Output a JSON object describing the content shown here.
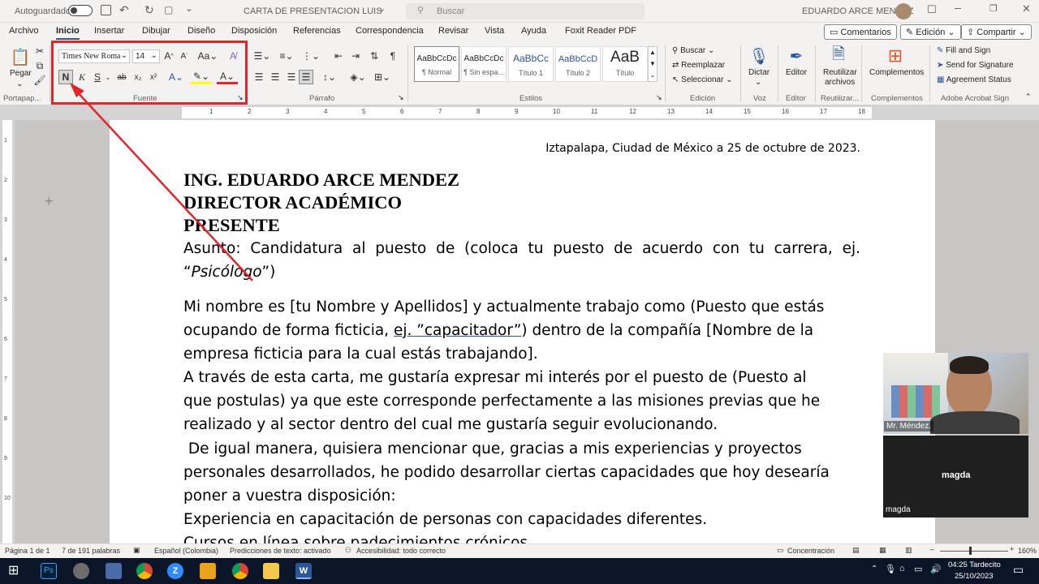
{
  "titlebar": {
    "autosave_label": "Autoguardado",
    "doc_title": "CARTA DE PRESENTACION LUIS",
    "dropdown_arrow": "⌄",
    "search_placeholder": "Buscar",
    "user_name": "EDUARDO ARCE MENDEZ"
  },
  "tabs": [
    "Archivo",
    "Inicio",
    "Insertar",
    "Dibujar",
    "Diseño",
    "Disposición",
    "Referencias",
    "Correspondencia",
    "Revisar",
    "Vista",
    "Ayuda",
    "Foxit Reader PDF"
  ],
  "top_buttons": {
    "comments": "Comentarios",
    "editing": "Edición",
    "share": "Compartir"
  },
  "ribbon": {
    "clipboard": {
      "paste": "Pegar",
      "label": "Portapap..."
    },
    "font": {
      "name": "Times New Roma",
      "size": "14",
      "bold": "N",
      "italic": "K",
      "underline": "S",
      "strike": "ab",
      "sub": "x₂",
      "sup": "x²",
      "label": "Fuente"
    },
    "paragraph": {
      "label": "Párrafo"
    },
    "styles": {
      "items": [
        {
          "preview": "AaBbCcDc",
          "name": "¶ Normal"
        },
        {
          "preview": "AaBbCcDc",
          "name": "¶ Sin espa..."
        },
        {
          "preview": "AaBbCc",
          "name": "Título 1"
        },
        {
          "preview": "AaBbCcD",
          "name": "Título 2"
        },
        {
          "preview": "AaB",
          "name": "Título"
        }
      ],
      "label": "Estilos"
    },
    "editing": {
      "find": "Buscar",
      "replace": "Reemplazar",
      "select": "Seleccionar",
      "label": "Edición"
    },
    "voice": {
      "dictate": "Dictar",
      "label": "Voz"
    },
    "editor": {
      "button": "Editor",
      "label": "Editor"
    },
    "reuse": {
      "button_line1": "Reutilizar",
      "button_line2": "archivos",
      "label": "Reutilizar..."
    },
    "addins": {
      "button": "Complementos",
      "label": "Complementos"
    },
    "acrobat": {
      "fill": "Fill and Sign",
      "send": "Send for Signature",
      "agreement": "Agreement Status",
      "label": "Adobe Acrobat Sign"
    }
  },
  "ruler_numbers": [
    "1",
    "2",
    "3",
    "4",
    "5",
    "6",
    "7",
    "8",
    "9",
    "10",
    "11",
    "12",
    "13",
    "14",
    "15",
    "16",
    "17",
    "18"
  ],
  "vruler_numbers": [
    "1",
    "2",
    "3",
    "4",
    "5",
    "6",
    "7",
    "8",
    "9",
    "10"
  ],
  "document": {
    "date_line": "Iztapalapa, Ciudad de México a 25 de octubre de 2023.",
    "heading1": "ING. EDUARDO ARCE MENDEZ",
    "heading2": "DIRECTOR ACADÉMICO",
    "heading3": "PRESENTE",
    "subject_line1": "Asunto: Candidatura al puesto de (coloca tu puesto de acuerdo con tu carrera, ej.",
    "subject_line2_pre": "“",
    "subject_line2_italic": "Psicólogo",
    "subject_line2_post": "”)",
    "p1_line1": "Mi nombre es [tu Nombre y Apellidos] y actualmente trabajo como (Puesto que estás",
    "p1_line2_pre": "ocupando de forma ficticia, ",
    "p1_line2_underlined": "ej. ”capacitador”",
    "p1_line2_post": ") dentro de la compañía [Nombre de la",
    "p1_line3": "empresa ficticia para la cual estás trabajando].",
    "p2_line1": "A través de esta carta, me gustaría expresar mi interés por el puesto de (Puesto al",
    "p2_line2": "que postulas) ya que este corresponde perfectamente a las misiones previas que he",
    "p2_line3": "realizado y al sector dentro del cual me gustaría seguir evolucionando.",
    "p3_line1": " De igual manera, quisiera mencionar que, gracias a mis experiencias y proyectos",
    "p3_line2": "personales desarrollados, he podido desarrollar ciertas capacidades que hoy desearía",
    "p3_line3": "poner a vuestra disposición:",
    "p4_line1": "Experiencia en capacitación de personas con capacidades diferentes.",
    "p4_line2": "Cursos en línea sobre padecimientos crónicos."
  },
  "video": {
    "participant1": "Mr. Méndez.",
    "participant2_center": "magda",
    "participant2_label": "magda"
  },
  "statusbar": {
    "page": "Página 1 de 1",
    "words": "7 de 191 palabras",
    "language": "Español (Colombia)",
    "predictions": "Predicciones de texto: activado",
    "accessibility": "Accesibilidad: todo correcto",
    "focus": "Concentración",
    "zoom": "160%"
  },
  "taskbar": {
    "time": "04:25 Tardecito",
    "date": "25/10/2023"
  },
  "colors": {
    "accent": "#2b579a",
    "annotation": "#e0262b"
  }
}
